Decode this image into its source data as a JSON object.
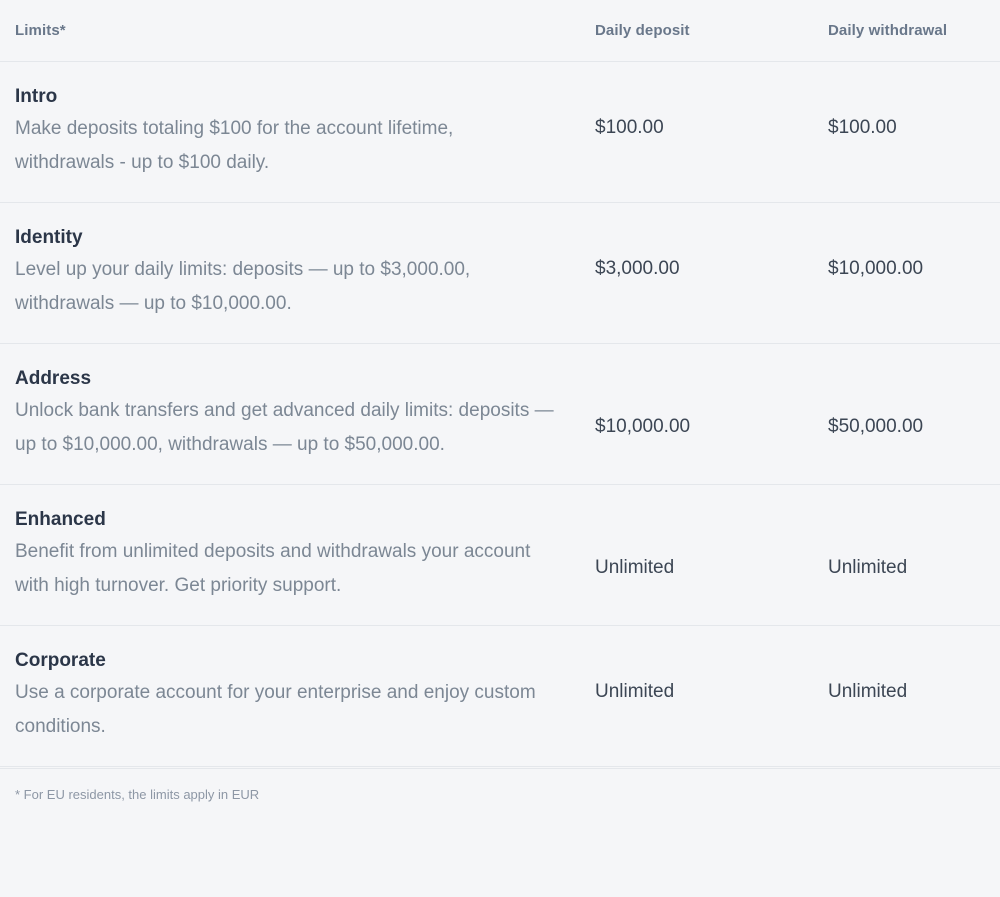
{
  "table": {
    "columns": {
      "tier": "Limits*",
      "daily_deposit": "Daily deposit",
      "daily_withdrawal": "Daily withdrawal"
    },
    "rows": [
      {
        "name": "Intro",
        "description": "Make deposits totaling $100 for the account lifetime, withdrawals - up to $100 daily.",
        "daily_deposit": "$100.00",
        "daily_withdrawal": "$100.00"
      },
      {
        "name": "Identity",
        "description": "Level up your daily limits: deposits — up to $3,000.00, withdrawals — up to $10,000.00.",
        "daily_deposit": "$3,000.00",
        "daily_withdrawal": "$10,000.00"
      },
      {
        "name": "Address",
        "description": "Unlock bank transfers and get advanced daily limits: deposits — up to $10,000.00, withdrawals — up to $50,000.00.",
        "daily_deposit": "$10,000.00",
        "daily_withdrawal": "$50,000.00"
      },
      {
        "name": "Enhanced",
        "description": "Benefit from unlimited deposits and withdrawals your account with high turnover. Get priority support.",
        "daily_deposit": "Unlimited",
        "daily_withdrawal": "Unlimited"
      },
      {
        "name": "Corporate",
        "description": "Use a corporate account for your enterprise and enjoy custom conditions.",
        "daily_deposit": "Unlimited",
        "daily_withdrawal": "Unlimited"
      }
    ],
    "footnote": "* For EU residents, the limits apply in EUR"
  },
  "colors": {
    "background": "#f5f6f8",
    "heading_text": "#2b3648",
    "muted_text": "#7c8794",
    "value_text": "#3c4654",
    "header_text": "#69778a",
    "divider": "#e4e7eb"
  }
}
